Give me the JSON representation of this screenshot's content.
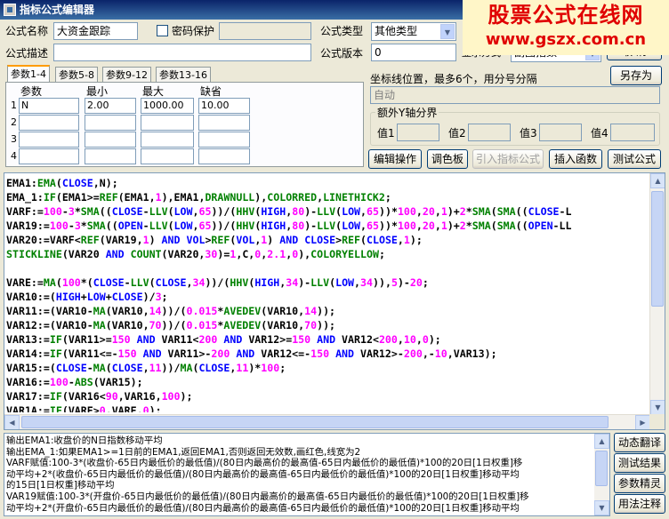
{
  "window": {
    "title": "指标公式编辑器"
  },
  "watermark": {
    "line1": "股票公式在线网",
    "line2": "www.gszx.com.cn"
  },
  "form": {
    "name_label": "公式名称",
    "name_value": "大资金跟踪",
    "password_label": "密码保护",
    "type_label": "公式类型",
    "type_value": "其他类型",
    "desc_label": "公式描述",
    "version_label": "公式版本",
    "version_value": "0",
    "display_partial": "显示方式",
    "display_value": "副图指数",
    "paint_partial": "画",
    "ok_partial": "确 定",
    "cancel_partial": "取 消",
    "save_as": "另存为"
  },
  "tabs": [
    "参数1-4",
    "参数5-8",
    "参数9-12",
    "参数13-16"
  ],
  "params": {
    "headers": [
      "参数",
      "最小",
      "最大",
      "缺省"
    ],
    "rows": [
      {
        "num": "1",
        "name": "N",
        "min": "2.00",
        "max": "1000.00",
        "default": "10.00"
      },
      {
        "num": "2",
        "name": "",
        "min": "",
        "max": "",
        "default": ""
      },
      {
        "num": "3",
        "name": "",
        "min": "",
        "max": "",
        "default": ""
      },
      {
        "num": "4",
        "name": "",
        "min": "",
        "max": "",
        "default": ""
      }
    ]
  },
  "coords": {
    "label": "坐标线位置，最多6个，用分号分隔",
    "value": "自动"
  },
  "yaxis": {
    "title": "额外Y轴分界",
    "labels": [
      "值1",
      "值2",
      "值3",
      "值4"
    ]
  },
  "buttons": {
    "edit": "编辑操作",
    "palette": "调色板",
    "import": "引入指标公式",
    "insert_fn": "插入函数",
    "test": "测试公式"
  },
  "side_buttons": [
    "动态翻译",
    "测试结果",
    "参数精灵",
    "用法注释"
  ],
  "code_lines": [
    [
      [
        "plain",
        "EMA1:"
      ],
      [
        "fn",
        "EMA"
      ],
      [
        "op",
        "("
      ],
      [
        "kw",
        "CLOSE"
      ],
      [
        "op",
        ",N);"
      ]
    ],
    [
      [
        "plain",
        "EMA_1:"
      ],
      [
        "fn",
        "IF"
      ],
      [
        "op",
        "(EMA1>="
      ],
      [
        "fn",
        "REF"
      ],
      [
        "op",
        "(EMA1,"
      ],
      [
        "num",
        "1"
      ],
      [
        "op",
        "),EMA1,"
      ],
      [
        "fn",
        "DRAWNULL"
      ],
      [
        "op",
        "),"
      ],
      [
        "fn",
        "COLORRED"
      ],
      [
        "op",
        ","
      ],
      [
        "fn",
        "LINETHICK2"
      ],
      [
        "op",
        ";"
      ]
    ],
    [
      [
        "plain",
        "VARF:="
      ],
      [
        "num",
        "100"
      ],
      [
        "op",
        "-"
      ],
      [
        "num",
        "3"
      ],
      [
        "op",
        "*"
      ],
      [
        "fn",
        "SMA"
      ],
      [
        "op",
        "(("
      ],
      [
        "kw",
        "CLOSE"
      ],
      [
        "op",
        "-"
      ],
      [
        "fn",
        "LLV"
      ],
      [
        "op",
        "("
      ],
      [
        "kw",
        "LOW"
      ],
      [
        "op",
        ","
      ],
      [
        "num",
        "65"
      ],
      [
        "op",
        "))/("
      ],
      [
        "fn",
        "HHV"
      ],
      [
        "op",
        "("
      ],
      [
        "kw",
        "HIGH"
      ],
      [
        "op",
        ","
      ],
      [
        "num",
        "80"
      ],
      [
        "op",
        ")-"
      ],
      [
        "fn",
        "LLV"
      ],
      [
        "op",
        "("
      ],
      [
        "kw",
        "LOW"
      ],
      [
        "op",
        ","
      ],
      [
        "num",
        "65"
      ],
      [
        "op",
        "))*"
      ],
      [
        "num",
        "100"
      ],
      [
        "op",
        ","
      ],
      [
        "num",
        "20"
      ],
      [
        "op",
        ","
      ],
      [
        "num",
        "1"
      ],
      [
        "op",
        ")+"
      ],
      [
        "num",
        "2"
      ],
      [
        "op",
        "*"
      ],
      [
        "fn",
        "SMA"
      ],
      [
        "op",
        "("
      ],
      [
        "fn",
        "SMA"
      ],
      [
        "op",
        "(("
      ],
      [
        "kw",
        "CLOSE"
      ],
      [
        "op",
        "-L"
      ]
    ],
    [
      [
        "plain",
        "VAR19:="
      ],
      [
        "num",
        "100"
      ],
      [
        "op",
        "-"
      ],
      [
        "num",
        "3"
      ],
      [
        "op",
        "*"
      ],
      [
        "fn",
        "SMA"
      ],
      [
        "op",
        "(("
      ],
      [
        "kw",
        "OPEN"
      ],
      [
        "op",
        "-"
      ],
      [
        "fn",
        "LLV"
      ],
      [
        "op",
        "("
      ],
      [
        "kw",
        "LOW"
      ],
      [
        "op",
        ","
      ],
      [
        "num",
        "65"
      ],
      [
        "op",
        "))/("
      ],
      [
        "fn",
        "HHV"
      ],
      [
        "op",
        "("
      ],
      [
        "kw",
        "HIGH"
      ],
      [
        "op",
        ","
      ],
      [
        "num",
        "80"
      ],
      [
        "op",
        ")-"
      ],
      [
        "fn",
        "LLV"
      ],
      [
        "op",
        "("
      ],
      [
        "kw",
        "LOW"
      ],
      [
        "op",
        ","
      ],
      [
        "num",
        "65"
      ],
      [
        "op",
        "))*"
      ],
      [
        "num",
        "100"
      ],
      [
        "op",
        ","
      ],
      [
        "num",
        "20"
      ],
      [
        "op",
        ","
      ],
      [
        "num",
        "1"
      ],
      [
        "op",
        ")+"
      ],
      [
        "num",
        "2"
      ],
      [
        "op",
        "*"
      ],
      [
        "fn",
        "SMA"
      ],
      [
        "op",
        "("
      ],
      [
        "fn",
        "SMA"
      ],
      [
        "op",
        "(("
      ],
      [
        "kw",
        "OPEN"
      ],
      [
        "op",
        "-LL"
      ]
    ],
    [
      [
        "plain",
        "VAR20:=VARF<"
      ],
      [
        "fn",
        "REF"
      ],
      [
        "op",
        "(VAR19,"
      ],
      [
        "num",
        "1"
      ],
      [
        "op",
        ") "
      ],
      [
        "kw",
        "AND"
      ],
      [
        "op",
        " "
      ],
      [
        "kw",
        "VOL"
      ],
      [
        "op",
        ">"
      ],
      [
        "fn",
        "REF"
      ],
      [
        "op",
        "("
      ],
      [
        "kw",
        "VOL"
      ],
      [
        "op",
        ","
      ],
      [
        "num",
        "1"
      ],
      [
        "op",
        ") "
      ],
      [
        "kw",
        "AND"
      ],
      [
        "op",
        " "
      ],
      [
        "kw",
        "CLOSE"
      ],
      [
        "op",
        ">"
      ],
      [
        "fn",
        "REF"
      ],
      [
        "op",
        "("
      ],
      [
        "kw",
        "CLOSE"
      ],
      [
        "op",
        ","
      ],
      [
        "num",
        "1"
      ],
      [
        "op",
        ");"
      ]
    ],
    [
      [
        "fn",
        "STICKLINE"
      ],
      [
        "op",
        "(VAR20 "
      ],
      [
        "kw",
        "AND"
      ],
      [
        "op",
        " "
      ],
      [
        "fn",
        "COUNT"
      ],
      [
        "op",
        "(VAR20,"
      ],
      [
        "num",
        "30"
      ],
      [
        "op",
        ")="
      ],
      [
        "num",
        "1"
      ],
      [
        "op",
        ",C,"
      ],
      [
        "num",
        "0"
      ],
      [
        "op",
        ","
      ],
      [
        "num",
        "2.1"
      ],
      [
        "op",
        ","
      ],
      [
        "num",
        "0"
      ],
      [
        "op",
        "),"
      ],
      [
        "fn",
        "COLORYELLOW"
      ],
      [
        "op",
        ";"
      ]
    ],
    [],
    [
      [
        "plain",
        "VARE:="
      ],
      [
        "fn",
        "MA"
      ],
      [
        "op",
        "("
      ],
      [
        "num",
        "100"
      ],
      [
        "op",
        "*("
      ],
      [
        "kw",
        "CLOSE"
      ],
      [
        "op",
        "-"
      ],
      [
        "fn",
        "LLV"
      ],
      [
        "op",
        "("
      ],
      [
        "kw",
        "CLOSE"
      ],
      [
        "op",
        ","
      ],
      [
        "num",
        "34"
      ],
      [
        "op",
        "))/("
      ],
      [
        "fn",
        "HHV"
      ],
      [
        "op",
        "("
      ],
      [
        "kw",
        "HIGH"
      ],
      [
        "op",
        ","
      ],
      [
        "num",
        "34"
      ],
      [
        "op",
        ")-"
      ],
      [
        "fn",
        "LLV"
      ],
      [
        "op",
        "("
      ],
      [
        "kw",
        "LOW"
      ],
      [
        "op",
        ","
      ],
      [
        "num",
        "34"
      ],
      [
        "op",
        ")),"
      ],
      [
        "num",
        "5"
      ],
      [
        "op",
        ")-"
      ],
      [
        "num",
        "20"
      ],
      [
        "op",
        ";"
      ]
    ],
    [
      [
        "plain",
        "VAR10:=("
      ],
      [
        "kw",
        "HIGH"
      ],
      [
        "op",
        "+"
      ],
      [
        "kw",
        "LOW"
      ],
      [
        "op",
        "+"
      ],
      [
        "kw",
        "CLOSE"
      ],
      [
        "op",
        ")/"
      ],
      [
        "num",
        "3"
      ],
      [
        "op",
        ";"
      ]
    ],
    [
      [
        "plain",
        "VAR11:=(VAR10-"
      ],
      [
        "fn",
        "MA"
      ],
      [
        "op",
        "(VAR10,"
      ],
      [
        "num",
        "14"
      ],
      [
        "op",
        "))/("
      ],
      [
        "num",
        "0.015"
      ],
      [
        "op",
        "*"
      ],
      [
        "fn",
        "AVEDEV"
      ],
      [
        "op",
        "(VAR10,"
      ],
      [
        "num",
        "14"
      ],
      [
        "op",
        "));"
      ]
    ],
    [
      [
        "plain",
        "VAR12:=(VAR10-"
      ],
      [
        "fn",
        "MA"
      ],
      [
        "op",
        "(VAR10,"
      ],
      [
        "num",
        "70"
      ],
      [
        "op",
        "))/("
      ],
      [
        "num",
        "0.015"
      ],
      [
        "op",
        "*"
      ],
      [
        "fn",
        "AVEDEV"
      ],
      [
        "op",
        "(VAR10,"
      ],
      [
        "num",
        "70"
      ],
      [
        "op",
        "));"
      ]
    ],
    [
      [
        "plain",
        "VAR13:="
      ],
      [
        "fn",
        "IF"
      ],
      [
        "op",
        "(VAR11>="
      ],
      [
        "num",
        "150"
      ],
      [
        "op",
        " "
      ],
      [
        "kw",
        "AND"
      ],
      [
        "op",
        " VAR11<"
      ],
      [
        "num",
        "200"
      ],
      [
        "op",
        " "
      ],
      [
        "kw",
        "AND"
      ],
      [
        "op",
        " VAR12>="
      ],
      [
        "num",
        "150"
      ],
      [
        "op",
        " "
      ],
      [
        "kw",
        "AND"
      ],
      [
        "op",
        " VAR12<"
      ],
      [
        "num",
        "200"
      ],
      [
        "op",
        ","
      ],
      [
        "num",
        "10"
      ],
      [
        "op",
        ","
      ],
      [
        "num",
        "0"
      ],
      [
        "op",
        ");"
      ]
    ],
    [
      [
        "plain",
        "VAR14:="
      ],
      [
        "fn",
        "IF"
      ],
      [
        "op",
        "(VAR11<=-"
      ],
      [
        "num",
        "150"
      ],
      [
        "op",
        " "
      ],
      [
        "kw",
        "AND"
      ],
      [
        "op",
        " VAR11>-"
      ],
      [
        "num",
        "200"
      ],
      [
        "op",
        " "
      ],
      [
        "kw",
        "AND"
      ],
      [
        "op",
        " VAR12<=-"
      ],
      [
        "num",
        "150"
      ],
      [
        "op",
        " "
      ],
      [
        "kw",
        "AND"
      ],
      [
        "op",
        " VAR12>-"
      ],
      [
        "num",
        "200"
      ],
      [
        "op",
        ",-"
      ],
      [
        "num",
        "10"
      ],
      [
        "op",
        ",VAR13);"
      ]
    ],
    [
      [
        "plain",
        "VAR15:=("
      ],
      [
        "kw",
        "CLOSE"
      ],
      [
        "op",
        "-"
      ],
      [
        "fn",
        "MA"
      ],
      [
        "op",
        "("
      ],
      [
        "kw",
        "CLOSE"
      ],
      [
        "op",
        ","
      ],
      [
        "num",
        "11"
      ],
      [
        "op",
        "))/"
      ],
      [
        "fn",
        "MA"
      ],
      [
        "op",
        "("
      ],
      [
        "kw",
        "CLOSE"
      ],
      [
        "op",
        ","
      ],
      [
        "num",
        "11"
      ],
      [
        "op",
        ")*"
      ],
      [
        "num",
        "100"
      ],
      [
        "op",
        ";"
      ]
    ],
    [
      [
        "plain",
        "VAR16:="
      ],
      [
        "num",
        "100"
      ],
      [
        "op",
        "-"
      ],
      [
        "fn",
        "ABS"
      ],
      [
        "op",
        "(VAR15);"
      ]
    ],
    [
      [
        "plain",
        "VAR17:="
      ],
      [
        "fn",
        "IF"
      ],
      [
        "op",
        "(VAR16<"
      ],
      [
        "num",
        "90"
      ],
      [
        "op",
        ",VAR16,"
      ],
      [
        "num",
        "100"
      ],
      [
        "op",
        ");"
      ]
    ],
    [
      [
        "plain",
        "VAR1A:="
      ],
      [
        "fn",
        "IF"
      ],
      [
        "op",
        "(VARE>"
      ],
      [
        "num",
        "0"
      ],
      [
        "op",
        ",VARE,"
      ],
      [
        "num",
        "0"
      ],
      [
        "op",
        ");"
      ]
    ]
  ],
  "output_lines": [
    "输出EMA1:收盘价的N日指数移动平均",
    "输出EMA_1:如果EMA1>=1日前的EMA1,返回EMA1,否则返回无效数,画红色,线宽为2",
    "VARF赋值:100-3*(收盘价-65日内最低价的最低值)/(80日内最高价的最高值-65日内最低价的最低值)*100的20日[1日权重]移",
    "动平均+2*(收盘价-65日内最低价的最低值)/(80日内最高价的最高值-65日内最低价的最低值)*100的20日[1日权重]移动平均",
    "的15日[1日权重]移动平均",
    "VAR19赋值:100-3*(开盘价-65日内最低价的最低值)/(80日内最高价的最高值-65日内最低价的最低值)*100的20日[1日权重]移",
    "动平均+2*(开盘价-65日内最低价的最低值)/(80日内最高价的最高值-65日内最低价的最低值)*100的20日[1日权重]移动平均"
  ]
}
